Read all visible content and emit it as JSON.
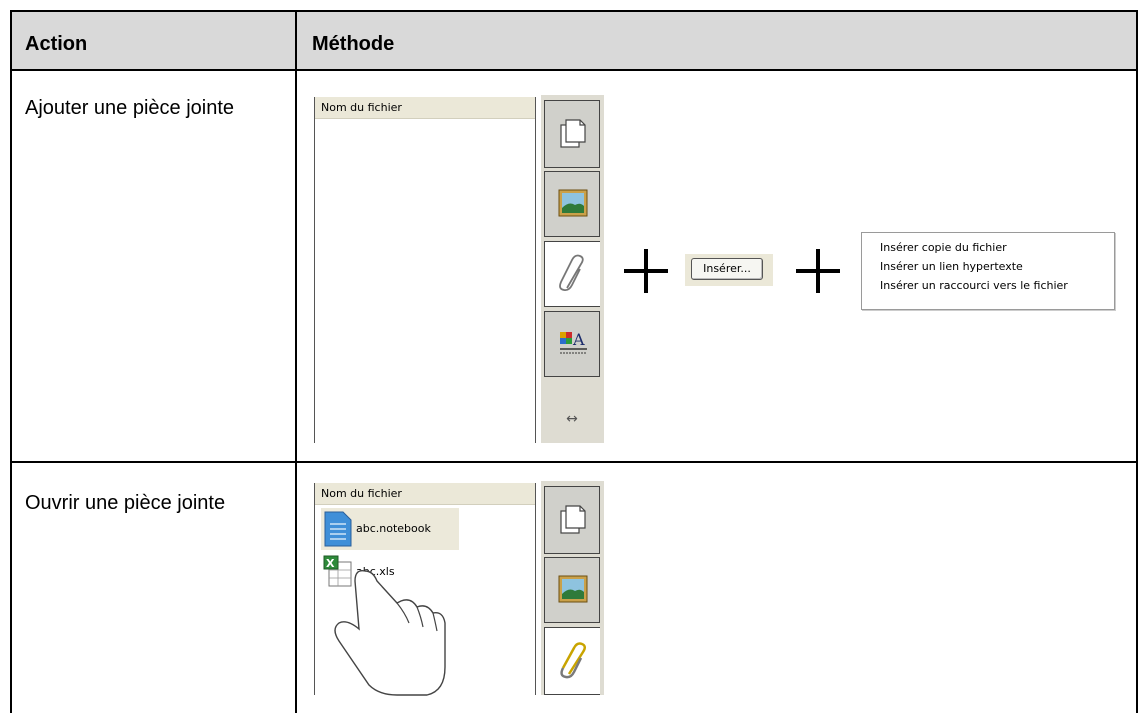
{
  "table": {
    "headers": {
      "action": "Action",
      "method": "Méthode"
    },
    "rows": [
      {
        "action": "Ajouter une pièce jointe"
      },
      {
        "action": "Ouvrir une pièce jointe"
      }
    ]
  },
  "attachments_panel_1": {
    "column_header": "Nom du fichier",
    "tabs": [
      "page-icon",
      "gallery-icon",
      "paperclip-icon",
      "properties-icon",
      "resize-arrows-icon"
    ]
  },
  "insert_button_label": "Insérer...",
  "insert_menu": {
    "items": [
      "Insérer copie du fichier",
      "Insérer un lien hypertexte",
      "Insérer un raccourci vers le fichier"
    ]
  },
  "attachments_panel_2": {
    "column_header": "Nom du fichier",
    "files": [
      "abc.notebook",
      "abc.xls"
    ]
  }
}
